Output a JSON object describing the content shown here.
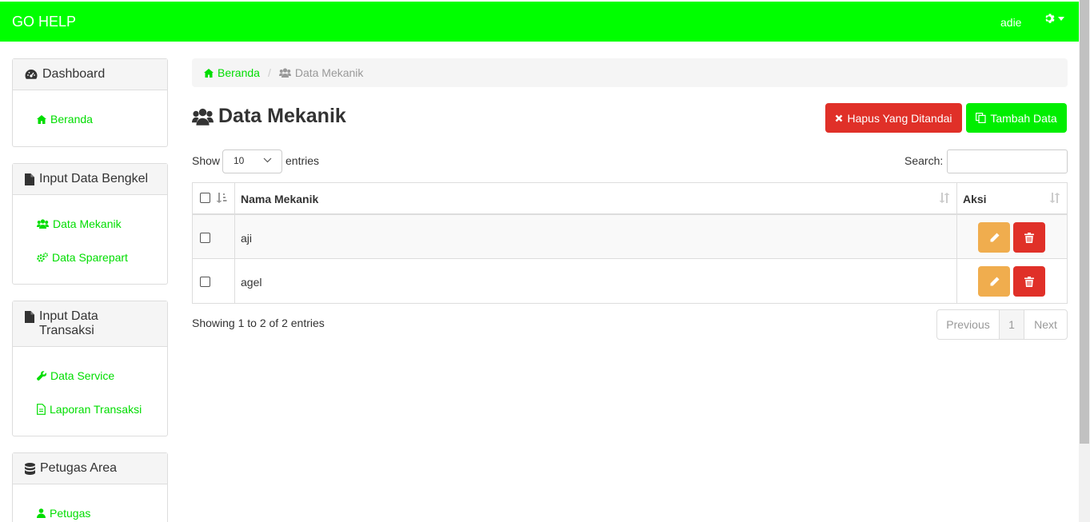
{
  "navbar": {
    "brand": "GO HELP",
    "user": "adie",
    "settings_icon": "gear-icon",
    "accent": "#00ff00"
  },
  "sidebar": {
    "panels": [
      {
        "title": "Dashboard",
        "icon": "dashboard-icon",
        "items": [
          {
            "label": "Beranda",
            "icon": "home-icon"
          }
        ]
      },
      {
        "title": "Input Data Bengkel",
        "icon": "file-icon",
        "items": [
          {
            "label": "Data Mekanik",
            "icon": "users-icon"
          },
          {
            "label": "Data Sparepart",
            "icon": "cogs-icon"
          }
        ]
      },
      {
        "title": "Input Data Transaksi",
        "icon": "file-icon",
        "items": [
          {
            "label": "Data Service",
            "icon": "wrench-icon"
          },
          {
            "label": "Laporan Transaksi",
            "icon": "file-text-icon"
          }
        ]
      },
      {
        "title": "Petugas Area",
        "icon": "database-icon",
        "items": [
          {
            "label": "Petugas",
            "icon": "user-icon"
          }
        ]
      }
    ]
  },
  "breadcrumb": {
    "home": "Beranda",
    "current": "Data Mekanik"
  },
  "page": {
    "title": "Data Mekanik",
    "title_icon": "users-icon"
  },
  "actions": {
    "delete_selected": "Hapus Yang Ditandai",
    "add": "Tambah Data",
    "danger_color": "#e03028",
    "success_color": "#00ee00"
  },
  "table_controls": {
    "show_label": "Show",
    "entries_value": "10",
    "entries_label": "entries",
    "search_label": "Search:",
    "search_value": ""
  },
  "table": {
    "columns": [
      "Nama Mekanik",
      "Aksi"
    ],
    "rows": [
      {
        "name": "aji"
      },
      {
        "name": "agel"
      }
    ],
    "edit_icon": "pencil-icon",
    "delete_icon": "trash-icon",
    "edit_color": "#f0ad4e"
  },
  "footer": {
    "info": "Showing 1 to 2 of 2 entries",
    "pagination": {
      "previous": "Previous",
      "current_page": "1",
      "next": "Next"
    }
  }
}
